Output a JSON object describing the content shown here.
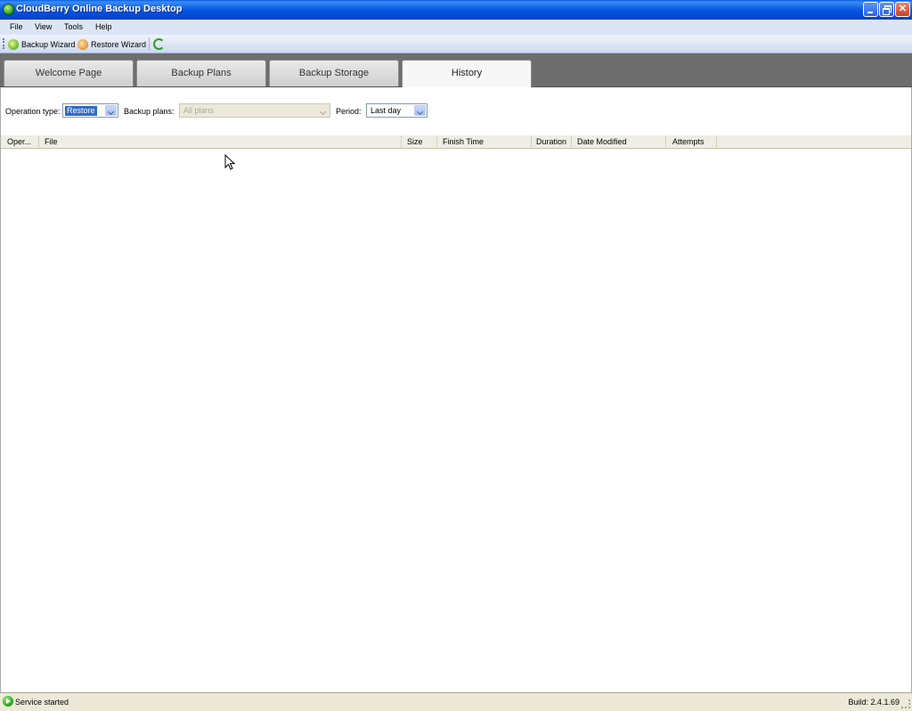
{
  "window": {
    "title": "CloudBerry Online Backup Desktop"
  },
  "menu": {
    "items": [
      "File",
      "View",
      "Tools",
      "Help"
    ]
  },
  "toolbar": {
    "backup_wizard": "Backup Wizard",
    "restore_wizard": "Restore Wizard"
  },
  "tabs": [
    "Welcome Page",
    "Backup Plans",
    "Backup Storage",
    "History"
  ],
  "active_tab": "History",
  "filters": {
    "operation_type_label": "Operation type:",
    "operation_type_value": "Restore",
    "backup_plans_label": "Backup plans:",
    "backup_plans_value": "All plans",
    "period_label": "Period:",
    "period_value": "Last day"
  },
  "grid": {
    "columns": [
      "Oper...",
      "File",
      "Size",
      "Finish Time",
      "Duration",
      "Date Modified",
      "Attempts"
    ]
  },
  "status": {
    "text": "Service started",
    "build": "Build: 2.4.1.69"
  }
}
